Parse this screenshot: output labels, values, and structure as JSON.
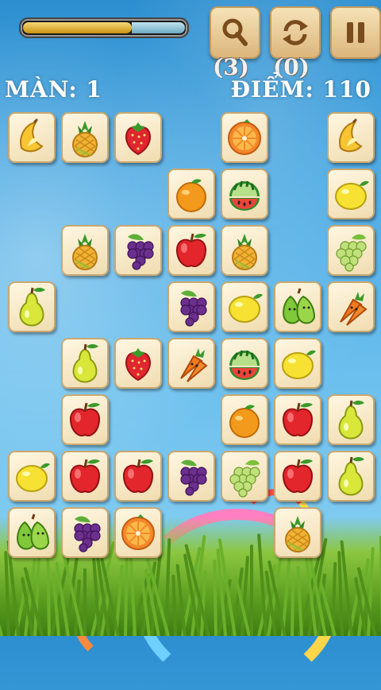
{
  "hud": {
    "progress_fraction": 0.68,
    "hint_count": "(3)",
    "shuffle_count": "(0)",
    "level_label": "MÀN: 1",
    "score_label": "ĐIỂM: 110"
  },
  "buttons": {
    "hint_icon": "magnifier-icon",
    "shuffle_icon": "refresh-icon",
    "pause_icon": "pause-icon"
  },
  "board": {
    "columns": 7,
    "rows": 8,
    "grid": [
      [
        "banana",
        "pineapple",
        "strawberry",
        "",
        "orange-slice",
        "",
        "banana"
      ],
      [
        "",
        "",
        "",
        "orange",
        "watermelon",
        "",
        "lemon"
      ],
      [
        "",
        "pineapple",
        "grapes",
        "apple",
        "pineapple",
        "",
        "white-grapes"
      ],
      [
        "pear",
        "",
        "",
        "grapes",
        "lemon",
        "green-pear",
        "carrot"
      ],
      [
        "",
        "pear",
        "strawberry",
        "carrot",
        "watermelon",
        "lemon",
        ""
      ],
      [
        "",
        "apple",
        "",
        "",
        "orange",
        "apple",
        "pear"
      ],
      [
        "lemon",
        "apple",
        "apple",
        "grapes",
        "white-grapes",
        "apple",
        "pear"
      ],
      [
        "green-pear",
        "grapes",
        "orange-slice",
        "",
        "",
        "pineapple",
        ""
      ]
    ]
  },
  "colors": {
    "sky_top": "#2d8fd0",
    "tile_border": "#c9a770",
    "button_bg": "#dcb67c",
    "progress_fill": "#c99410"
  }
}
